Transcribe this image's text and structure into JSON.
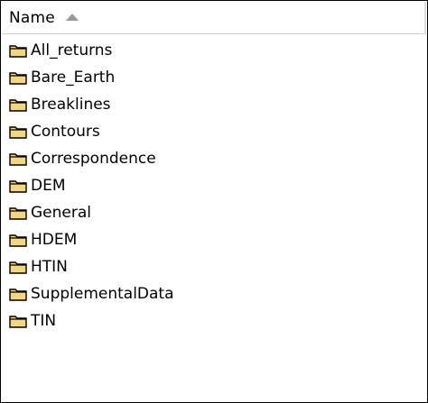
{
  "list_header": {
    "name_label": "Name",
    "sort_icon": "sort-ascending-icon"
  },
  "folders": [
    {
      "name": "All_returns",
      "icon": "folder-icon"
    },
    {
      "name": "Bare_Earth",
      "icon": "folder-icon"
    },
    {
      "name": "Breaklines",
      "icon": "folder-icon"
    },
    {
      "name": "Contours",
      "icon": "folder-icon"
    },
    {
      "name": "Correspondence",
      "icon": "folder-icon"
    },
    {
      "name": "DEM",
      "icon": "folder-icon"
    },
    {
      "name": "General",
      "icon": "folder-icon"
    },
    {
      "name": "HDEM",
      "icon": "folder-icon"
    },
    {
      "name": "HTIN",
      "icon": "folder-icon"
    },
    {
      "name": "SupplementalData",
      "icon": "folder-icon"
    },
    {
      "name": "TIN",
      "icon": "folder-icon"
    }
  ],
  "colors": {
    "folder_fill": "#f4d77a",
    "folder_outline": "#000000",
    "text": "#000000",
    "background": "#ffffff"
  }
}
